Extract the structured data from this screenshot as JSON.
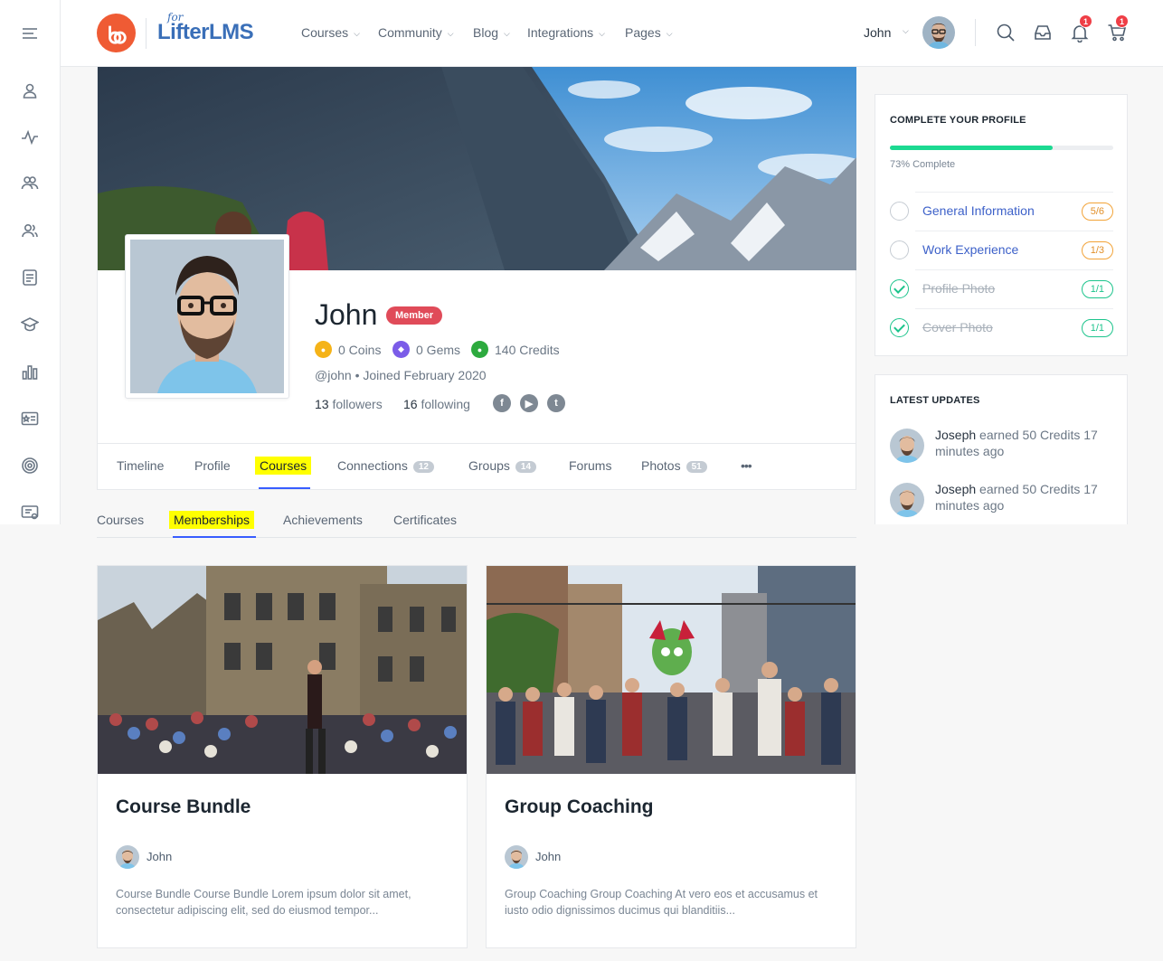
{
  "brand": {
    "logo_prefix": "for",
    "logo_text": "LifterLMS",
    "accent": "#ef5b34"
  },
  "nav": {
    "items": [
      {
        "label": "Courses"
      },
      {
        "label": "Community"
      },
      {
        "label": "Blog"
      },
      {
        "label": "Integrations"
      },
      {
        "label": "Pages"
      }
    ]
  },
  "user": {
    "name": "John",
    "notifications_count": "1",
    "cart_count": "1"
  },
  "rail": {
    "icons": [
      "menu-icon",
      "profile-icon",
      "activity-icon",
      "groups-icon",
      "members-icon",
      "forums-icon",
      "courses-icon",
      "stats-icon",
      "badges-icon",
      "target-icon",
      "certificate-icon"
    ]
  },
  "profile": {
    "name": "John",
    "role_badge": "Member",
    "points": [
      {
        "label": "0 Coins",
        "color": "#f5b318"
      },
      {
        "label": "0 Gems",
        "color": "#7b5ce8"
      },
      {
        "label": "140 Credits",
        "color": "#2daa3e"
      }
    ],
    "handle": "@john",
    "joined": "Joined February 2020",
    "followers_count": "13",
    "followers_label": "followers",
    "following_count": "16",
    "following_label": "following",
    "social": [
      "facebook-icon",
      "youtube-icon",
      "twitter-icon"
    ]
  },
  "profile_tabs": [
    {
      "label": "Timeline"
    },
    {
      "label": "Profile"
    },
    {
      "label": "Courses",
      "active": true
    },
    {
      "label": "Connections",
      "count": "12"
    },
    {
      "label": "Groups",
      "count": "14"
    },
    {
      "label": "Forums"
    },
    {
      "label": "Photos",
      "count": "51"
    },
    {
      "label": "•••"
    }
  ],
  "sub_tabs": [
    {
      "label": "Courses"
    },
    {
      "label": "Memberships",
      "active": true
    },
    {
      "label": "Achievements"
    },
    {
      "label": "Certificates"
    }
  ],
  "complete_profile": {
    "title": "COMPLETE YOUR PROFILE",
    "percent": 73,
    "percent_label": "73% Complete",
    "items": [
      {
        "label": "General Information",
        "count": "5/6",
        "done": false
      },
      {
        "label": "Work Experience",
        "count": "1/3",
        "done": false
      },
      {
        "label": "Profile Photo",
        "count": "1/1",
        "done": true
      },
      {
        "label": "Cover Photo",
        "count": "1/1",
        "done": true
      }
    ]
  },
  "latest_updates": {
    "title": "LATEST UPDATES",
    "items": [
      {
        "actor": "Joseph",
        "text": "earned 50 Credits 17 minutes ago"
      },
      {
        "actor": "Joseph",
        "text": "earned 50 Credits 17 minutes ago"
      }
    ]
  },
  "memberships": [
    {
      "title": "Course Bundle",
      "author": "John",
      "description": "Course Bundle Course Bundle Lorem ipsum dolor sit amet, consectetur adipiscing elit, sed do eiusmod tempor..."
    },
    {
      "title": "Group Coaching",
      "author": "John",
      "description": "Group Coaching Group Coaching At vero eos et accusamus et iusto odio dignissimos ducimus qui blanditiis..."
    }
  ]
}
